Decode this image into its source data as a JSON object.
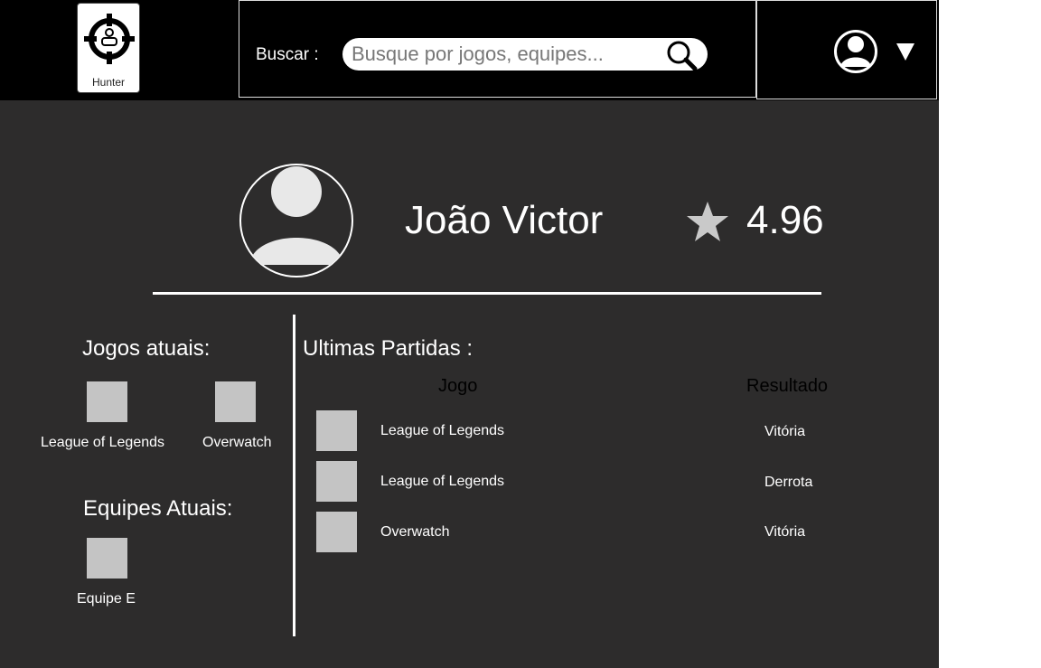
{
  "header": {
    "logo_text": "Hunter",
    "search_label": "Buscar :",
    "search_placeholder": "Busque por jogos, equipes...",
    "search_icon": "search-icon",
    "user_icon": "user-avatar-icon",
    "menu_icon": "caret-down-icon"
  },
  "profile": {
    "name": "João Victor",
    "rating": "4.96",
    "rating_icon": "star-icon"
  },
  "current_games": {
    "title": "Jogos atuais:",
    "items": [
      {
        "label": "League of Legends"
      },
      {
        "label": "Overwatch"
      }
    ]
  },
  "current_teams": {
    "title": "Equipes Atuais:",
    "items": [
      {
        "label": "Equipe E"
      }
    ]
  },
  "recent_matches": {
    "title": "Ultimas Partidas :",
    "headers": {
      "game": "Jogo",
      "result": "Resultado"
    },
    "rows": [
      {
        "game": "League of Legends",
        "result": "Vitória"
      },
      {
        "game": "League of Legends",
        "result": "Derrota"
      },
      {
        "game": "Overwatch",
        "result": "Vitória"
      }
    ]
  },
  "colors": {
    "background": "#2d2c2c",
    "header": "#000000",
    "text": "#ffffff",
    "placeholder_tile": "#c4c4c4",
    "star": "#c9c9c9"
  }
}
